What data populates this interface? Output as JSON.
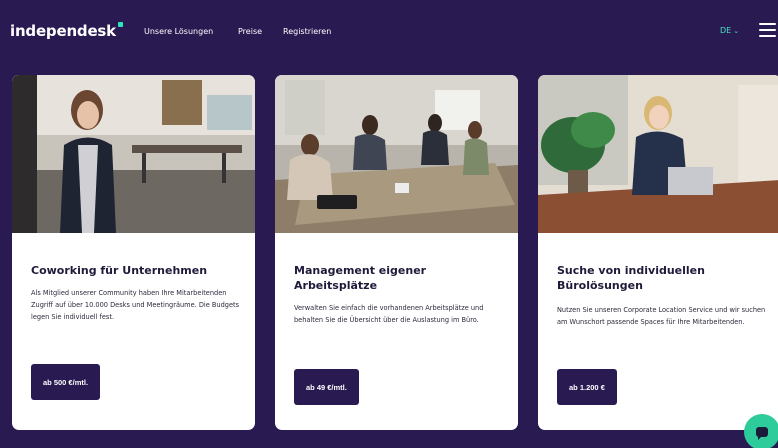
{
  "header": {
    "logo_text": "independesk",
    "nav": {
      "solutions": "Unsere Lösungen",
      "prices": "Preise",
      "register": "Registrieren"
    },
    "language": "DE",
    "icons": [
      "chevron-down-icon",
      "hamburger-menu-icon"
    ]
  },
  "cards": [
    {
      "title": "Coworking für Unternehmen",
      "description": "Als Mitglied unserer Community haben Ihre Mitarbeitenden Zugriff auf über 10.000 Desks und Meetingräume. Die Budgets legen Sie individuell fest.",
      "price": "ab 500 €/mtl."
    },
    {
      "title": "Management eigener Arbeitsplätze",
      "description": "Verwalten Sie einfach die vorhandenen Arbeitsplätze und behalten Sie die Übersicht über die Auslastung im Büro.",
      "price": "ab 49 €/mtl."
    },
    {
      "title": "Suche von individuellen Bürolösungen",
      "description": "Nutzen Sie unseren Corporate Location Service und wir suchen am Wunschort passende Spaces für Ihre Mitarbeitenden.",
      "price": "ab 1.200 €"
    }
  ],
  "colors": {
    "background": "#2a1a52",
    "accent": "#2ee6b8",
    "button": "#2a1a52",
    "chat": "#2ecc9a"
  }
}
